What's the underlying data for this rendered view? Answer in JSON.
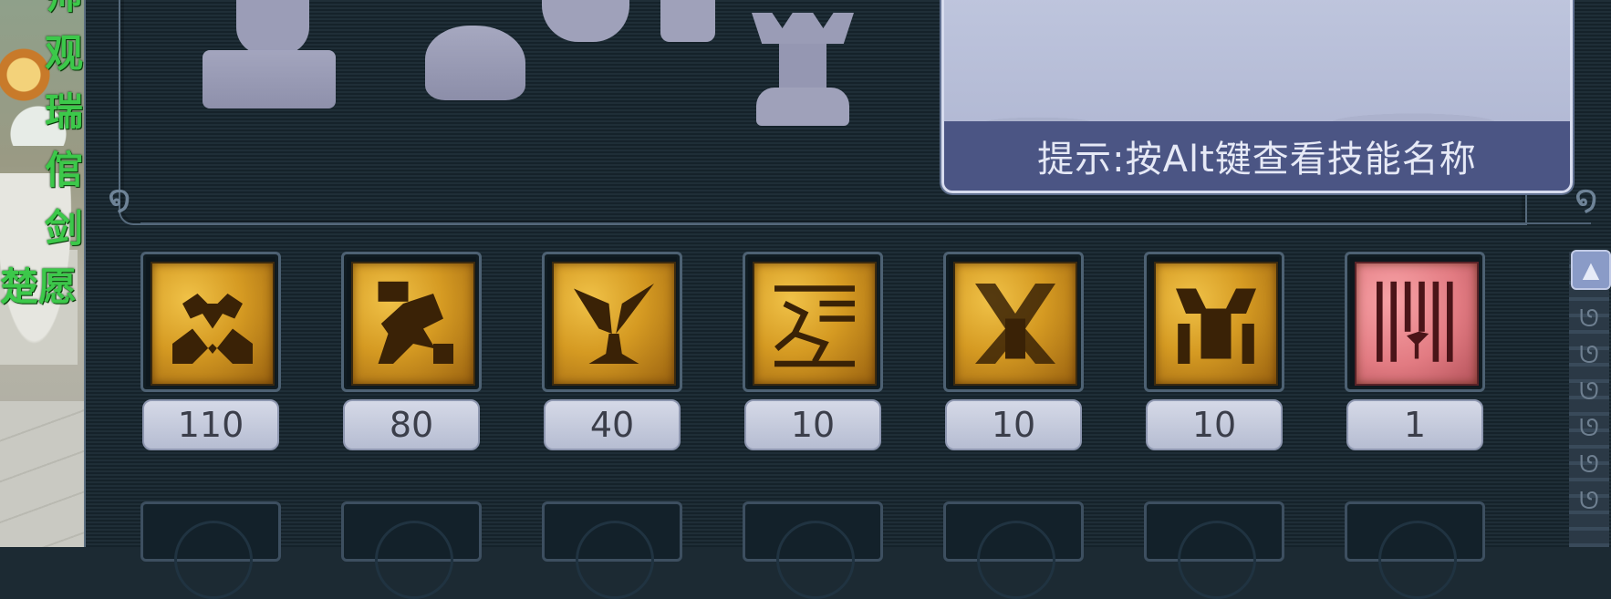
{
  "world": {
    "side_chars": [
      "师",
      "观",
      "瑞",
      "倌",
      "剑",
      "楚愿"
    ]
  },
  "tip": {
    "text": "提示:按Alt键查看技能名称"
  },
  "skills": [
    {
      "icon": "gold-skill-emblem-icon",
      "level": "110"
    },
    {
      "icon": "gold-skill-warrior-icon",
      "level": "80"
    },
    {
      "icon": "gold-skill-sprout-icon",
      "level": "40"
    },
    {
      "icon": "gold-skill-running-icon",
      "level": "10"
    },
    {
      "icon": "gold-skill-crossed-icon",
      "level": "10"
    },
    {
      "icon": "gold-skill-helmet-icon",
      "level": "10"
    },
    {
      "icon": "pink-skill-seedling-icon",
      "level": "1"
    }
  ],
  "colors": {
    "panel_bg": "#1c2a33",
    "gold_icon": "#d59a22",
    "pink_icon": "#e27b82",
    "tip_bar": "#4b5584",
    "side_text": "#3cc84a"
  }
}
